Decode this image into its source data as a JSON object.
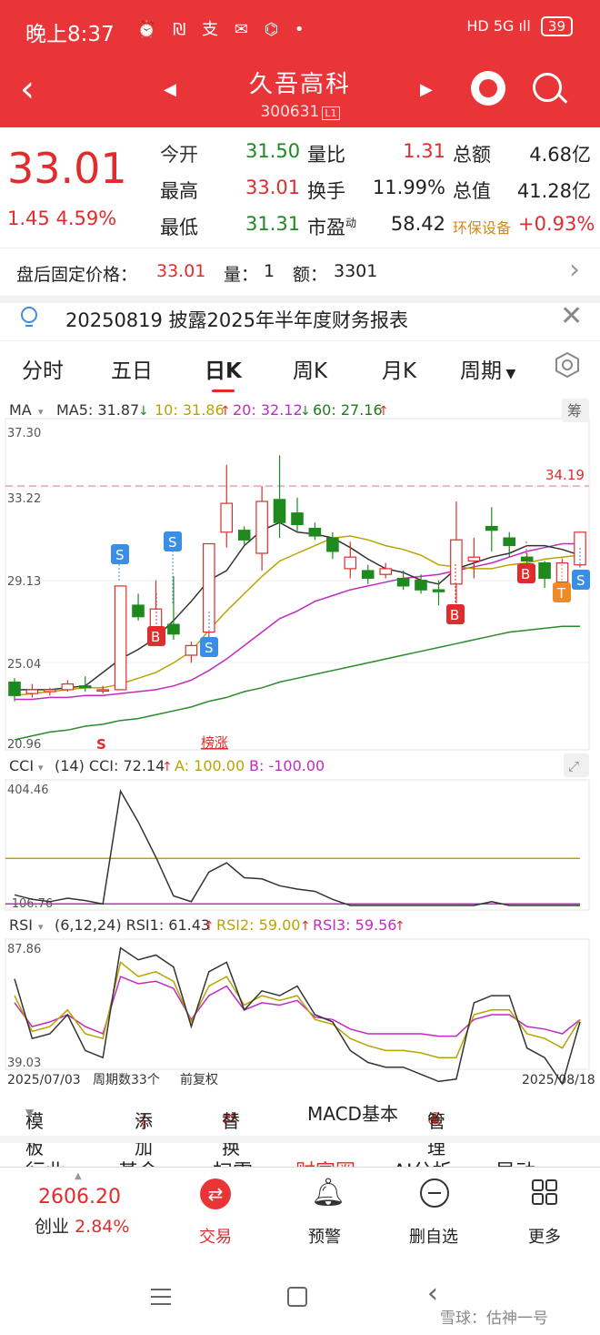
{
  "status": {
    "time": "晚上8:37",
    "icons": "⏰ ₪ 支 ✉ ⌬ •",
    "network": "HD 5G ıll",
    "battery": "39"
  },
  "header": {
    "name": "久吾高科",
    "code": "300631",
    "code_tag": "L1"
  },
  "quote": {
    "price": "33.01",
    "change": "1.45",
    "change_pct": "4.59%",
    "rows": [
      {
        "l1": "今开",
        "v1": "31.50",
        "l2": "量比",
        "v2": "1.31",
        "l3": "总额",
        "v3": "4.68亿"
      },
      {
        "l1": "最高",
        "v1": "33.01",
        "l2": "换手",
        "v2": "11.99%",
        "l3": "总值",
        "v3": "41.28亿"
      },
      {
        "l1": "最低",
        "v1": "31.31",
        "l2": "市盈",
        "l2_sup": "动",
        "v2": "58.42",
        "l3": "环保设备",
        "v3": "+0.93%"
      }
    ]
  },
  "after_hours": {
    "label": "盘后固定价格：",
    "price": "33.01",
    "vol_label": "量：",
    "vol": "1",
    "amt_label": "额：",
    "amt": "3301"
  },
  "notice": {
    "text": "20250819 披露2025年半年度财务报表"
  },
  "tabs": [
    "分时",
    "五日",
    "日K",
    "周K",
    "月K",
    "周期"
  ],
  "active_tab": "日K",
  "indicators": {
    "ma": {
      "name": "MA",
      "ma5": "MA5: 31.87",
      "ma10": "10: 31.86",
      "ma20": "20: 32.12",
      "ma60": "60: 27.16",
      "chip": "筹"
    },
    "cci": {
      "name": "CCI",
      "text": "(14) CCI: 72.14",
      "a": "A: 100.00",
      "b": "B: -100.00"
    },
    "rsi": {
      "name": "RSI",
      "text": "(6,12,24) RSI1: 61.43",
      "rsi2": "RSI2: 59.00",
      "rsi3": "RSI3: 59.56"
    }
  },
  "axis": {
    "price_ticks": [
      "37.30",
      "33.22",
      "29.13",
      "25.04",
      "20.96"
    ],
    "cci_ticks": [
      "404.46",
      "-106.76"
    ],
    "rsi_ticks": [
      "87.86",
      "39.03"
    ],
    "date_start": "2025/07/03",
    "date_end": "2025/08/18",
    "period_count": "周期数33个",
    "adjust": "前复权",
    "resistance": "34.19",
    "markers_s": "S",
    "bang": "榜涨"
  },
  "chart_data": {
    "type": "candlestick",
    "ylim": [
      20.96,
      37.3
    ],
    "candles": [
      [
        24.3,
        23.6,
        24.5,
        23.3
      ],
      [
        23.7,
        23.9,
        24.2,
        23.5
      ],
      [
        23.8,
        23.9,
        24.0,
        23.6
      ],
      [
        23.9,
        24.2,
        24.4,
        23.8
      ],
      [
        24.1,
        24.0,
        24.6,
        23.8
      ],
      [
        23.9,
        23.9,
        24.1,
        23.7
      ],
      [
        23.9,
        29.3,
        29.3,
        23.9
      ],
      [
        28.3,
        27.7,
        28.9,
        27.5
      ],
      [
        26.8,
        28.1,
        29.6,
        26.3
      ],
      [
        27.3,
        26.8,
        29.8,
        26.5
      ],
      [
        25.7,
        26.2,
        26.4,
        25.3
      ],
      [
        26.9,
        31.5,
        31.5,
        26.2
      ],
      [
        32.1,
        33.6,
        35.6,
        31.3
      ],
      [
        32.2,
        31.7,
        32.4,
        31.4
      ],
      [
        31.0,
        33.7,
        34.5,
        30.1
      ],
      [
        33.8,
        32.6,
        36.1,
        31.8
      ],
      [
        33.1,
        32.5,
        33.9,
        32.1
      ],
      [
        32.3,
        31.9,
        32.6,
        31.7
      ],
      [
        31.8,
        31.1,
        32.1,
        30.7
      ],
      [
        30.2,
        30.8,
        31.6,
        29.7
      ],
      [
        30.1,
        29.7,
        30.4,
        29.4
      ],
      [
        29.9,
        30.2,
        30.5,
        29.7
      ],
      [
        29.7,
        29.3,
        30.1,
        29.1
      ],
      [
        29.6,
        29.1,
        29.9,
        28.9
      ],
      [
        29.1,
        29.0,
        29.6,
        28.3
      ],
      [
        29.4,
        31.7,
        33.7,
        28.4
      ],
      [
        30.6,
        30.8,
        31.8,
        29.7
      ],
      [
        32.4,
        32.2,
        33.4,
        31.1
      ],
      [
        31.8,
        31.4,
        32.1,
        30.8
      ],
      [
        30.8,
        30.6,
        31.0,
        30.0
      ],
      [
        30.5,
        29.7,
        30.6,
        29.2
      ],
      [
        29.5,
        30.5,
        30.7,
        28.9
      ],
      [
        30.4,
        32.1,
        32.1,
        30.3
      ]
    ],
    "ma5": [
      23.9,
      23.9,
      23.9,
      24.0,
      24.1,
      24.8,
      25.5,
      26.0,
      26.6,
      27.5,
      28.5,
      29.6,
      30.1,
      31.4,
      32.2,
      32.6,
      32.1,
      32.0,
      31.8,
      31.3,
      30.7,
      30.2,
      30.0,
      29.6,
      29.4,
      30.2,
      30.5,
      30.8,
      31.0,
      31.4,
      31.4,
      31.2,
      30.9
    ],
    "ma10": [
      23.6,
      23.7,
      23.8,
      23.9,
      24.0,
      24.0,
      24.2,
      24.5,
      24.8,
      25.3,
      25.9,
      27.0,
      28.0,
      28.9,
      29.8,
      30.6,
      31.0,
      31.4,
      31.8,
      31.9,
      31.7,
      31.4,
      31.2,
      30.9,
      30.4,
      30.3,
      30.2,
      30.2,
      30.4,
      30.5,
      30.7,
      30.8,
      30.9
    ],
    "ma20": [
      23.4,
      23.4,
      23.5,
      23.5,
      23.6,
      23.6,
      23.7,
      23.8,
      23.9,
      24.1,
      24.4,
      24.9,
      25.5,
      26.2,
      26.9,
      27.6,
      28.0,
      28.5,
      28.8,
      29.1,
      29.3,
      29.5,
      29.7,
      29.8,
      29.9,
      30.1,
      30.3,
      30.5,
      30.8,
      31.1,
      31.3,
      31.5,
      31.5
    ],
    "ma60": [
      21.3,
      21.5,
      21.7,
      21.8,
      22.0,
      22.1,
      22.3,
      22.4,
      22.6,
      22.8,
      23.0,
      23.3,
      23.5,
      23.8,
      24.0,
      24.3,
      24.5,
      24.7,
      24.9,
      25.1,
      25.3,
      25.5,
      25.7,
      25.9,
      26.1,
      26.3,
      26.5,
      26.7,
      26.9,
      27.0,
      27.1,
      27.2,
      27.2
    ],
    "cci": [
      -60,
      -80,
      -90,
      -75,
      -85,
      -100,
      395,
      260,
      105,
      -65,
      -90,
      40,
      80,
      15,
      10,
      -20,
      -35,
      -45,
      -80,
      -120,
      -140,
      -150,
      -170,
      -190,
      -210,
      -160,
      -120,
      -90,
      -140,
      -140,
      -160,
      -150,
      -110
    ],
    "rsi1": [
      75,
      50,
      52,
      60,
      45,
      42,
      88,
      83,
      85,
      80,
      55,
      78,
      82,
      62,
      70,
      68,
      72,
      60,
      57,
      45,
      40,
      38,
      38,
      35,
      32,
      33,
      65,
      68,
      68,
      46,
      42,
      30,
      57
    ],
    "rsi2": [
      68,
      53,
      55,
      62,
      52,
      50,
      82,
      76,
      78,
      74,
      57,
      72,
      76,
      64,
      68,
      66,
      68,
      58,
      56,
      50,
      47,
      45,
      45,
      44,
      42,
      42,
      60,
      62,
      62,
      52,
      50,
      46,
      58
    ],
    "rsi3": [
      65,
      55,
      57,
      60,
      55,
      52,
      76,
      73,
      74,
      71,
      58,
      68,
      72,
      62,
      65,
      64,
      66,
      59,
      58,
      54,
      52,
      52,
      52,
      52,
      51,
      51,
      58,
      60,
      60,
      55,
      54,
      52,
      58
    ]
  },
  "toolbar": {
    "template": "模板",
    "add": "添加",
    "replace": "替换",
    "macd": "MACD基本",
    "manage": "管理"
  },
  "subtabs": [
    "行业",
    "基金",
    "扫雷",
    "财富圈",
    "AI分析",
    "异动"
  ],
  "bottom_nav": {
    "index_value": "2606.20",
    "index_name": "创业",
    "index_pct": "2.84%",
    "trade": "交易",
    "alert": "预警",
    "remove": "删自选",
    "more": "更多"
  },
  "watermark": "雪球：估神一号"
}
